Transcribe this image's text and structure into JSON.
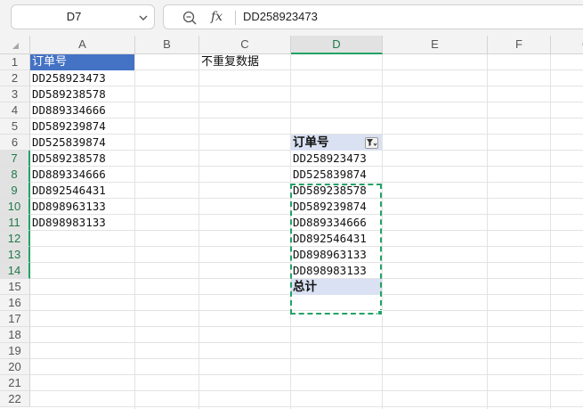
{
  "formula_bar": {
    "name_box": "D7",
    "fx_label": "fx",
    "value": "DD258923473"
  },
  "columns": [
    "A",
    "B",
    "C",
    "D",
    "E",
    "F",
    "G"
  ],
  "rows": [
    "1",
    "2",
    "3",
    "4",
    "5",
    "6",
    "7",
    "8",
    "9",
    "10",
    "11",
    "12",
    "13",
    "14",
    "15",
    "16",
    "17",
    "18",
    "19",
    "20",
    "21",
    "22"
  ],
  "selected_column": "D",
  "selected_rows": [
    "7",
    "8",
    "9",
    "10",
    "11",
    "12",
    "13",
    "14"
  ],
  "cells": {
    "A1": "订单号",
    "A2": "DD258923473",
    "A3": "DD589238578",
    "A4": "DD889334666",
    "A5": "DD589239874",
    "A6": "DD525839874",
    "A7": "DD589238578",
    "A8": "DD889334666",
    "A9": "DD892546431",
    "A10": "DD898963133",
    "A11": "DD898983133",
    "C1": "不重复数据"
  },
  "pivot": {
    "header": "订单号",
    "items": [
      "DD258923473",
      "DD525839874",
      "DD589238578",
      "DD589239874",
      "DD889334666",
      "DD892546431",
      "DD898963133",
      "DD898983133"
    ],
    "total": "总计"
  },
  "colors": {
    "header_fill": "#4472c4",
    "pivot_fill": "#d9e1f2",
    "selection": "#21a366"
  }
}
